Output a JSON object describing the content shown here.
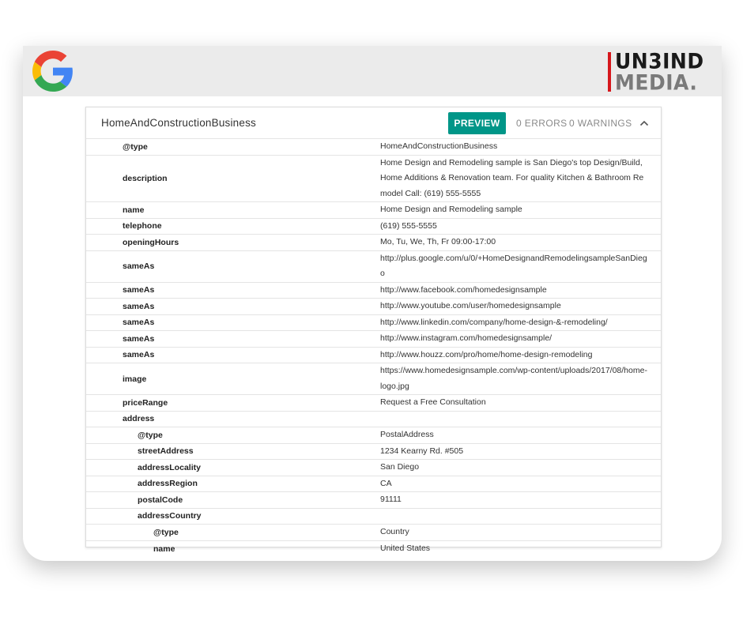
{
  "branding": {
    "google_logo": "google-g-icon",
    "partner_logo_top": "UN3IND",
    "partner_logo_bottom": "MEDIA."
  },
  "header": {
    "title": "HomeAndConstructionBusiness",
    "preview_label": "PREVIEW",
    "errors_label": "0 ERRORS",
    "warnings_label": "0 WARNINGS",
    "collapse_icon": "chevron-up-icon"
  },
  "colors": {
    "accent": "#009688",
    "partner_red": "#d6171c"
  },
  "rows": [
    {
      "level": 0,
      "prop": "@type",
      "value": "HomeAndConstructionBusiness"
    },
    {
      "level": 0,
      "prop": "description",
      "value": "Home Design and Remodeling sample is San Diego's top Design/Build, Home Additions & Renovation team. For quality Kitchen & Bathroom Remodel Call: (619) 555-5555"
    },
    {
      "level": 0,
      "prop": "name",
      "value": "Home Design and Remodeling sample"
    },
    {
      "level": 0,
      "prop": "telephone",
      "value": "(619) 555-5555"
    },
    {
      "level": 0,
      "prop": "openingHours",
      "value": "Mo, Tu, We, Th, Fr 09:00-17:00"
    },
    {
      "level": 0,
      "prop": "sameAs",
      "value": "http://plus.google.com/u/0/+HomeDesignandRemodelingsampleSanDiego"
    },
    {
      "level": 0,
      "prop": "sameAs",
      "value": "http://www.facebook.com/homedesignsample"
    },
    {
      "level": 0,
      "prop": "sameAs",
      "value": "http://www.youtube.com/user/homedesignsample"
    },
    {
      "level": 0,
      "prop": "sameAs",
      "value": "http://www.linkedin.com/company/home-design-&-remodeling/"
    },
    {
      "level": 0,
      "prop": "sameAs",
      "value": "http://www.instagram.com/homedesignsample/"
    },
    {
      "level": 0,
      "prop": "sameAs",
      "value": "http://www.houzz.com/pro/home/home-design-remodeling"
    },
    {
      "level": 0,
      "prop": "image",
      "value": "https://www.homedesignsample.com/wp-content/uploads/2017/08/home-logo.jpg"
    },
    {
      "level": 0,
      "prop": "priceRange",
      "value": "Request a Free Consultation"
    },
    {
      "level": 0,
      "prop": "address",
      "value": ""
    },
    {
      "level": 1,
      "prop": "@type",
      "value": "PostalAddress"
    },
    {
      "level": 1,
      "prop": "streetAddress",
      "value": "1234 Kearny Rd. #505"
    },
    {
      "level": 1,
      "prop": "addressLocality",
      "value": "San Diego"
    },
    {
      "level": 1,
      "prop": "addressRegion",
      "value": "CA"
    },
    {
      "level": 1,
      "prop": "postalCode",
      "value": "91111"
    },
    {
      "level": 1,
      "prop": "addressCountry",
      "value": ""
    },
    {
      "level": 2,
      "prop": "@type",
      "value": "Country"
    },
    {
      "level": 2,
      "prop": "name",
      "value": "United States"
    }
  ]
}
